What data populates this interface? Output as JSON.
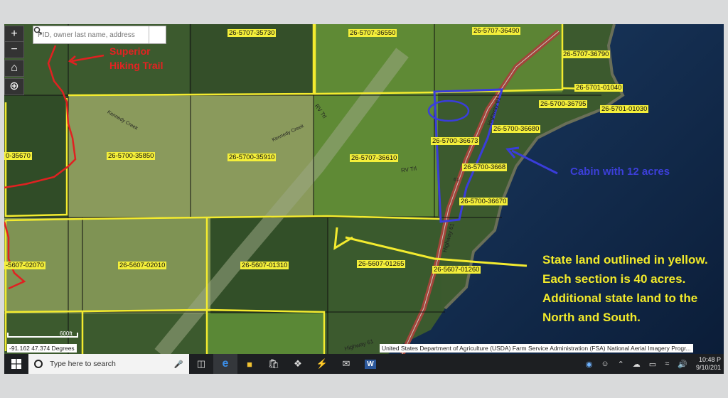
{
  "search": {
    "placeholder": "PID, owner last name, address"
  },
  "map_controls": {
    "zoom_in": "+",
    "zoom_out": "−"
  },
  "parcels": [
    {
      "pid": "26-5707-35730"
    },
    {
      "pid": "26-5707-36550"
    },
    {
      "pid": "26-5707-36490"
    },
    {
      "pid": "26-5707-36790"
    },
    {
      "pid": "26-5701-01040"
    },
    {
      "pid": "26-5700-36795"
    },
    {
      "pid": "26-5701-01030"
    },
    {
      "pid": "26-5700-36680"
    },
    {
      "pid": "26-5700-36673"
    },
    {
      "pid": "26-5700-35850"
    },
    {
      "pid": "26-5700-35910"
    },
    {
      "pid": "26-5707-36610"
    },
    {
      "pid": "0-35670"
    },
    {
      "pid": "26-5700-3668"
    },
    {
      "pid": "26-5700-36670"
    },
    {
      "pid": "-5607-02070"
    },
    {
      "pid": "26-5607-02010"
    },
    {
      "pid": "26-5607-01310"
    },
    {
      "pid": "26-5607-01265"
    },
    {
      "pid": "26-5607-01260"
    }
  ],
  "road_labels": [
    "RV Trl",
    "RV Trl",
    "Highway 61",
    "61",
    "Highway 61",
    "Highway 61",
    "Kennedy Creek",
    "Kennedy Creek"
  ],
  "annotations": {
    "trail": "Superior Hiking Trail",
    "cabin": "Cabin with 12 acres",
    "state": "State land outlined in yellow.  Each section is 40 acres.  Additional state land to the North and South."
  },
  "scale": "600ft",
  "coords": "-91.162 47.374 Degrees",
  "attribution": "United States Department of Agriculture (USDA) Farm Service Administration (FSA) National Aerial Imagery Progr...",
  "taskbar": {
    "search_placeholder": "Type here to search"
  },
  "clock": {
    "time": "10:48 P",
    "date": "9/10/201"
  },
  "colors": {
    "state_outline": "#f3eb2f",
    "trail": "#e02121",
    "cabin": "#3a3ddb",
    "water": "#10284a"
  }
}
